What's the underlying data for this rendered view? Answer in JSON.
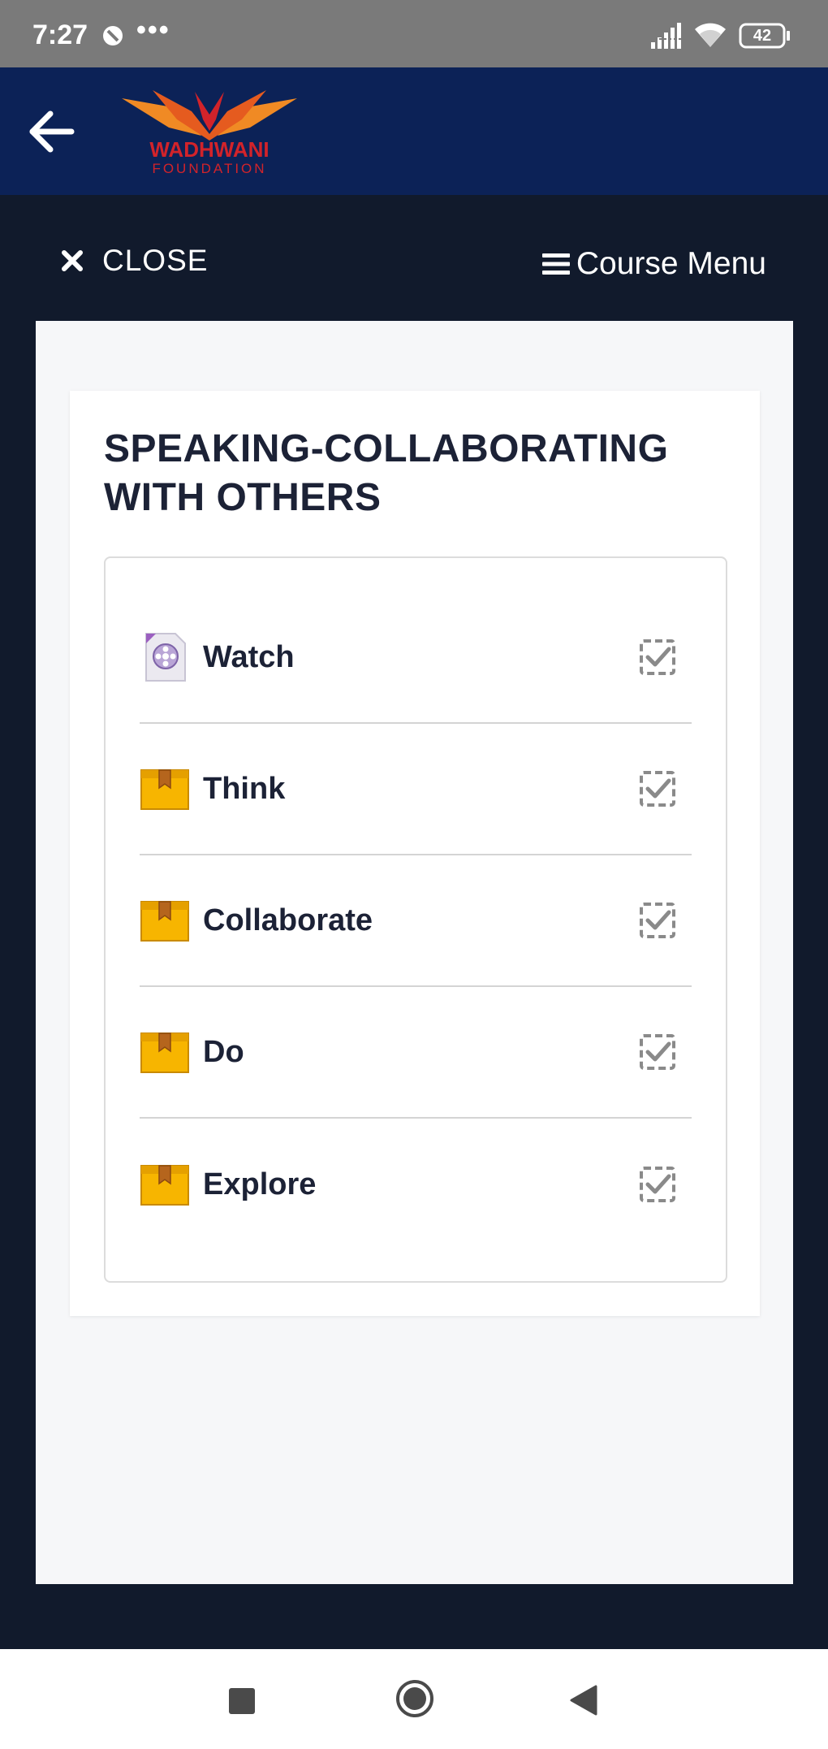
{
  "status_bar": {
    "time": "7:27",
    "dots": "•••",
    "battery": "42"
  },
  "header": {
    "logo_text": "WADHWANI",
    "logo_subtext": "FOUNDATION",
    "colors": {
      "background": "#0c2257",
      "logo_orange": "#f08a24",
      "logo_red": "#d2232a"
    }
  },
  "course_bar": {
    "close_label": "CLOSE",
    "menu_label": "Course Menu"
  },
  "card": {
    "title": "SPEAKING-COLLABORATING WITH OTHERS"
  },
  "items": [
    {
      "label": "Watch",
      "icon": "video-file-icon",
      "completed": true
    },
    {
      "label": "Think",
      "icon": "package-icon",
      "completed": true
    },
    {
      "label": "Collaborate",
      "icon": "package-icon",
      "completed": true
    },
    {
      "label": "Do",
      "icon": "package-icon",
      "completed": true
    },
    {
      "label": "Explore",
      "icon": "package-icon",
      "completed": true
    }
  ]
}
